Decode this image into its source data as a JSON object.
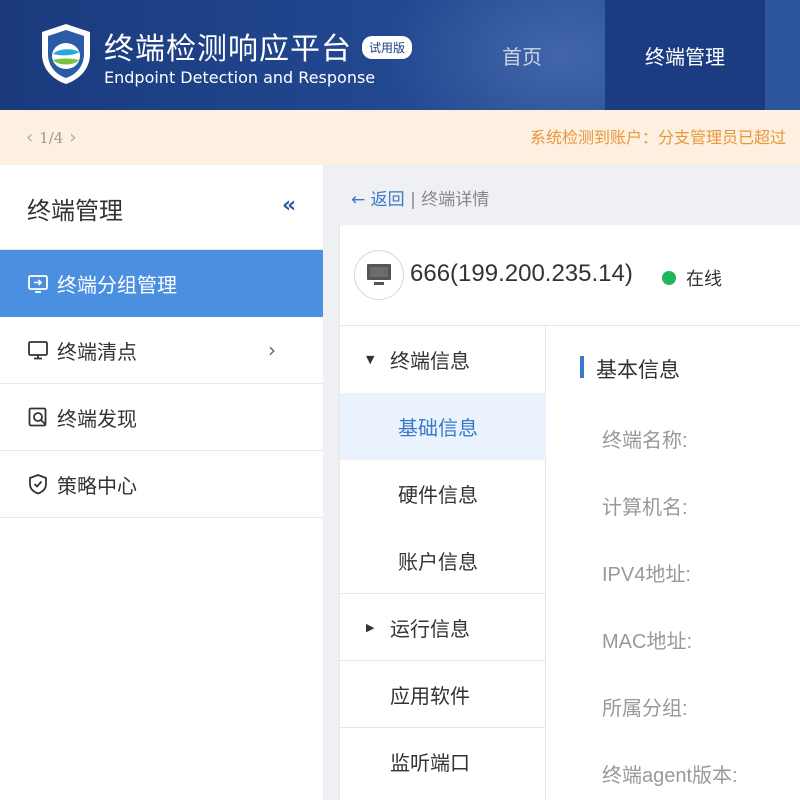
{
  "header": {
    "title": "终端检测响应平台",
    "badge": "试用版",
    "subtitle": "Endpoint Detection and Response",
    "nav": [
      {
        "label": "首页",
        "active": false
      },
      {
        "label": "终端管理",
        "active": true
      }
    ],
    "colors": {
      "bg": "#1f4289",
      "active_tab": "#1b3c80"
    }
  },
  "notice": {
    "pager": "1/4",
    "text": "系统检测到账户：分支管理员已超过"
  },
  "sidebar": {
    "title": "终端管理",
    "collapse_icon": "double-chevron-left-icon",
    "items": [
      {
        "label": "终端分组管理",
        "icon": "monitor-group-icon",
        "active": true
      },
      {
        "label": "终端清点",
        "icon": "monitor-icon",
        "active": false,
        "has_submenu": true
      },
      {
        "label": "终端发现",
        "icon": "search-doc-icon",
        "active": false
      },
      {
        "label": "策略中心",
        "icon": "shield-check-icon",
        "active": false
      }
    ]
  },
  "breadcrumb": {
    "back": "← 返回",
    "separator": "|",
    "current": "终端详情"
  },
  "device": {
    "name": "666(199.200.235.14)",
    "status": "在线",
    "status_color": "#21b55b"
  },
  "subnav": {
    "groups": [
      {
        "label": "终端信息",
        "expanded": true,
        "children": [
          "基础信息",
          "硬件信息",
          "账户信息"
        ],
        "active_child": "基础信息"
      },
      {
        "label": "运行信息",
        "expanded": false
      },
      {
        "label": "应用软件"
      },
      {
        "label": "监听端口"
      }
    ]
  },
  "detail": {
    "section_title": "基本信息",
    "fields": [
      "终端名称:",
      "计算机名:",
      "IPV4地址:",
      "MAC地址:",
      "所属分组:",
      "终端agent版本:"
    ]
  }
}
